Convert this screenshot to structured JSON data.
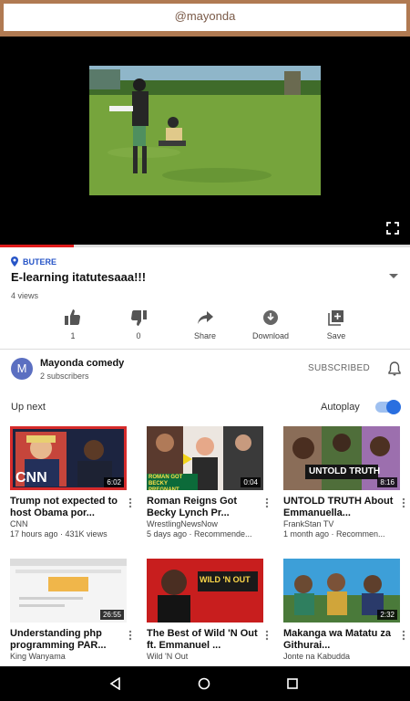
{
  "watermark": "@mayonda",
  "player": {
    "progress_fraction": 0.18
  },
  "video": {
    "location": "BUTERE",
    "title": "E-learning itatutesaaa!!!",
    "views": "4 views"
  },
  "actions": [
    {
      "icon": "thumbs-up-icon",
      "label": "1"
    },
    {
      "icon": "thumbs-down-icon",
      "label": "0"
    },
    {
      "icon": "share-icon",
      "label": "Share"
    },
    {
      "icon": "download-icon",
      "label": "Download"
    },
    {
      "icon": "add-to-playlist-icon",
      "label": "Save"
    }
  ],
  "channel": {
    "avatar_letter": "M",
    "name": "Mayonda comedy",
    "subscribers": "2 subscribers",
    "subscribe_label": "SUBSCRIBED"
  },
  "upnext": {
    "label": "Up next",
    "autoplay_label": "Autoplay",
    "autoplay_on": true
  },
  "recommendations": [
    {
      "title": "Trump not expected to host Obama por...",
      "channel": "CNN",
      "meta": "17 hours ago · 431K views",
      "duration": "6:02",
      "thumb_text": "CNN"
    },
    {
      "title": "Roman Reigns Got Becky Lynch Pr...",
      "channel": "WrestlingNewsNow",
      "meta": "5 days ago · Recommende...",
      "duration": "0:04",
      "thumb_text": "ROMAN GOT BECKY PREGNANT"
    },
    {
      "title": "UNTOLD TRUTH About Emmanuella...",
      "channel": "FrankStan TV",
      "meta": "1 month ago · Recommen...",
      "duration": "8:16",
      "thumb_text": "UNTOLD TRUTH"
    },
    {
      "title": "Understanding php programming PAR...",
      "channel": "King Wanyama",
      "meta": "",
      "duration": "26:55",
      "thumb_text": ""
    },
    {
      "title": "The Best of Wild 'N Out ft. Emmanuel ...",
      "channel": "Wild 'N Out",
      "meta": "",
      "duration": "",
      "thumb_text": "WILD 'N OUT"
    },
    {
      "title": "Makanga wa Matatu za Githurai...",
      "channel": "Jonte na Kabudda",
      "meta": "",
      "duration": "2:32",
      "thumb_text": ""
    }
  ],
  "colors": {
    "accent": "#2a6fe0",
    "progress": "#e01b1b",
    "location": "#2755c7"
  }
}
